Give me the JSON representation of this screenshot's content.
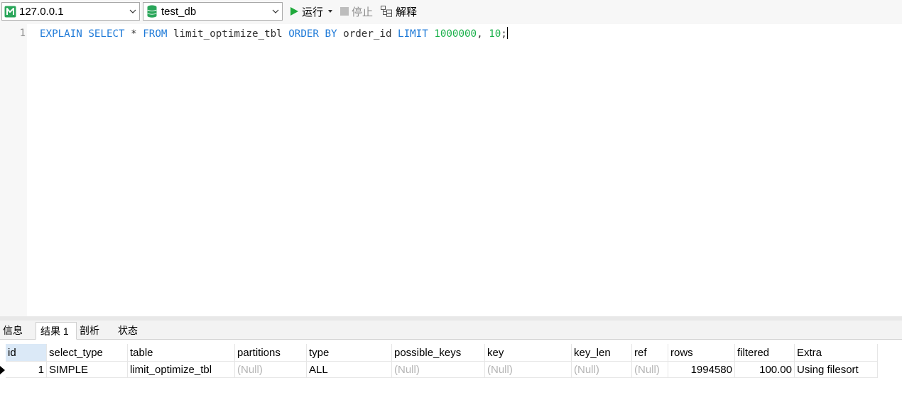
{
  "toolbar": {
    "connection": {
      "value": "127.0.0.1",
      "icon": "connection-icon",
      "color": "#2aa65a"
    },
    "database": {
      "value": "test_db",
      "icon": "database-icon",
      "color": "#2aa65a"
    },
    "run_label": "运行",
    "stop_label": "停止",
    "explain_label": "解释"
  },
  "editor": {
    "line_number": "1",
    "tokens": [
      "EXPLAIN",
      "SELECT",
      "*",
      "FROM",
      "limit_optimize_tbl",
      "ORDER",
      "BY",
      "order_id",
      "LIMIT",
      "1000000",
      ",",
      "10",
      ";"
    ]
  },
  "tabs": [
    "信息",
    "结果 1",
    "剖析",
    "状态"
  ],
  "result": {
    "columns": [
      "id",
      "select_type",
      "table",
      "partitions",
      "type",
      "possible_keys",
      "key",
      "key_len",
      "ref",
      "rows",
      "filtered",
      "Extra"
    ],
    "rows": [
      [
        "1",
        "SIMPLE",
        "limit_optimize_tbl",
        "(Null)",
        "ALL",
        "(Null)",
        "(Null)",
        "(Null)",
        "(Null)",
        "1994580",
        "100.00",
        "Using filesort"
      ]
    ]
  },
  "colors": {
    "keyword": "#1e7ad8",
    "number": "#19b04a",
    "null_text": "#b4b4b4",
    "run_green": "#1fa93b"
  }
}
